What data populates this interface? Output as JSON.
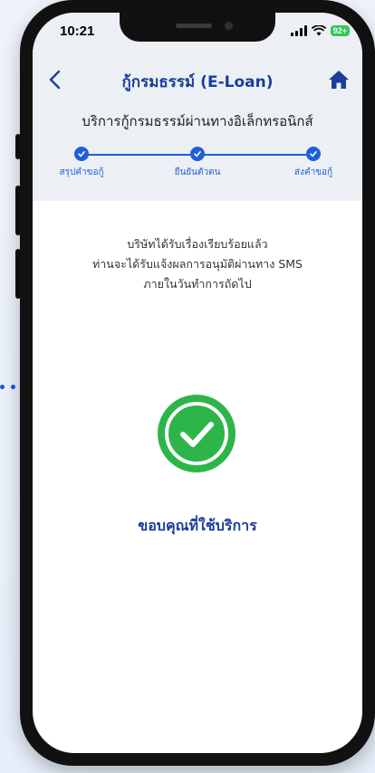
{
  "status_bar": {
    "time": "10:21",
    "battery": "92+"
  },
  "header": {
    "title": "กู้กรมธรรม์ (E-Loan)",
    "back_icon": "chevron-left-icon",
    "home_icon": "home-icon"
  },
  "subtitle": "บริการกู้กรมธรรม์ผ่านทางอิเล็กทรอนิกส์",
  "steps": [
    {
      "label": "สรุปคำขอกู้",
      "completed": true
    },
    {
      "label": "ยืนยันตัวตน",
      "completed": true
    },
    {
      "label": "ส่งคำขอกู้",
      "completed": true
    }
  ],
  "message": {
    "line1": "บริษัทได้รับเรื่องเรียบร้อยแล้ว",
    "line2": "ท่านจะได้รับแจ้งผลการอนุมัติผ่านทาง SMS",
    "line3": "ภายในวันทำการถัดไป"
  },
  "success_icon": "check-circle-icon",
  "thanks": "ขอบคุณที่ใช้บริการ",
  "colors": {
    "primary": "#1f5fd8",
    "title": "#1b3d9b",
    "success": "#2eb54a",
    "header_bg": "#eceff3"
  }
}
